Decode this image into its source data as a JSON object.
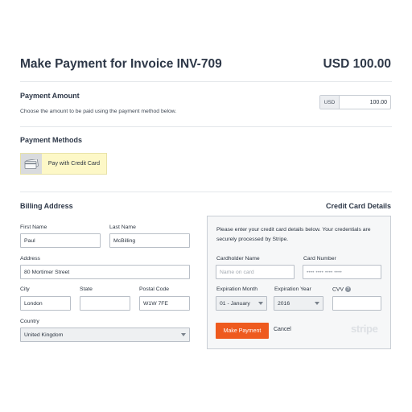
{
  "header": {
    "title": "Make Payment for Invoice INV-709",
    "total": "USD 100.00"
  },
  "payment_amount": {
    "title": "Payment Amount",
    "description": "Choose the amount to be paid using the payment method below.",
    "currency": "USD",
    "value": "100.00"
  },
  "payment_methods": {
    "title": "Payment Methods",
    "selected_label": "Pay with Credit Card",
    "icon": "credit-card-icon"
  },
  "billing": {
    "title": "Billing Address",
    "first_name_label": "First Name",
    "first_name": "Paul",
    "last_name_label": "Last Name",
    "last_name": "McBilling",
    "address_label": "Address",
    "address": "80 Mortimer Street",
    "city_label": "City",
    "city": "London",
    "state_label": "State",
    "state": "",
    "postal_label": "Postal Code",
    "postal": "W1W 7FE",
    "country_label": "Country",
    "country": "United Kingdom"
  },
  "card": {
    "title": "Credit Card Details",
    "intro": "Please enter your credit card details below. Your credentials are securely processed by Stripe.",
    "holder_label": "Cardholder Name",
    "holder_placeholder": "Name on card",
    "number_label": "Card Number",
    "number_placeholder": "•••• •••• •••• ••••",
    "month_label": "Expiration Month",
    "month": "01 - January",
    "year_label": "Expiration Year",
    "year": "2016",
    "cvv_label": "CVV",
    "cvv": "",
    "pay_button": "Make Payment",
    "cancel": "Cancel",
    "brand": "stripe"
  },
  "colors": {
    "accent": "#ee5a1e",
    "method_highlight": "#fdf8c7"
  }
}
